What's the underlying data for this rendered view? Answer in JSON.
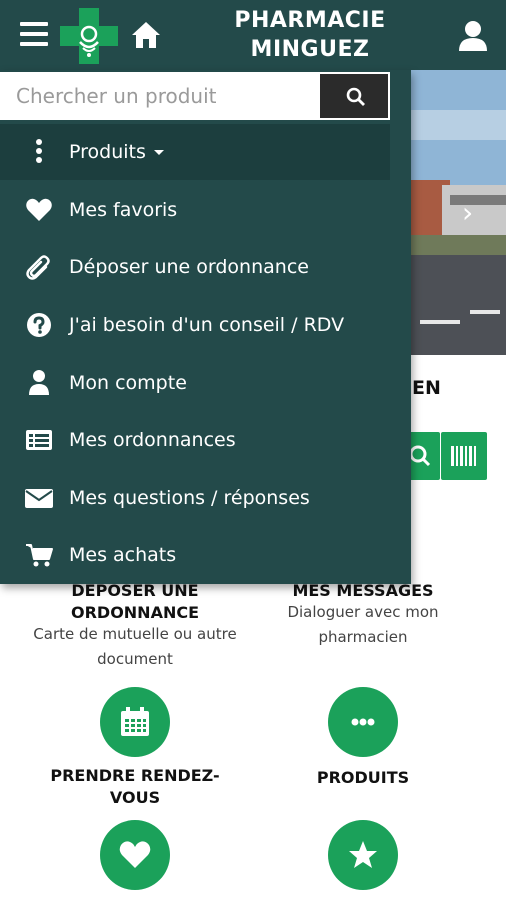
{
  "header": {
    "title_line1": "PHARMACIE",
    "title_line2": "MINGUEZ"
  },
  "background": {
    "heading_fragment": "EN",
    "tiles": [
      {
        "title_line1": "DEPOSER UNE",
        "title_line2": "ORDONNANCE",
        "sub_line1": "Carte de mutuelle ou autre",
        "sub_line2": "document"
      },
      {
        "title_line1": "MES MESSAGES",
        "sub_line1": "Dialoguer avec mon",
        "sub_line2": "pharmacien"
      },
      {
        "title_line1": "PRENDRE RENDEZ-",
        "title_line2": "VOUS"
      },
      {
        "title_line1": "PRODUITS"
      }
    ]
  },
  "drawer": {
    "search_placeholder": "Chercher un produit",
    "items": [
      {
        "label": "Produits",
        "icon": "vertical-ellipsis-icon",
        "active": true
      },
      {
        "label": "Mes favoris",
        "icon": "heart-icon"
      },
      {
        "label": "Déposer une ordonnance",
        "icon": "paperclip-icon"
      },
      {
        "label": "J'ai besoin d'un conseil / RDV",
        "icon": "question-circle-icon"
      },
      {
        "label": "Mon compte",
        "icon": "user-icon"
      },
      {
        "label": "Mes ordonnances",
        "icon": "list-icon"
      },
      {
        "label": "Mes questions / réponses",
        "icon": "envelope-icon"
      },
      {
        "label": "Mes achats",
        "icon": "cart-icon"
      }
    ]
  },
  "colors": {
    "header_bg": "#234a4a",
    "accent_green": "#1ba15a",
    "active_item_bg": "#1c3e3e"
  }
}
